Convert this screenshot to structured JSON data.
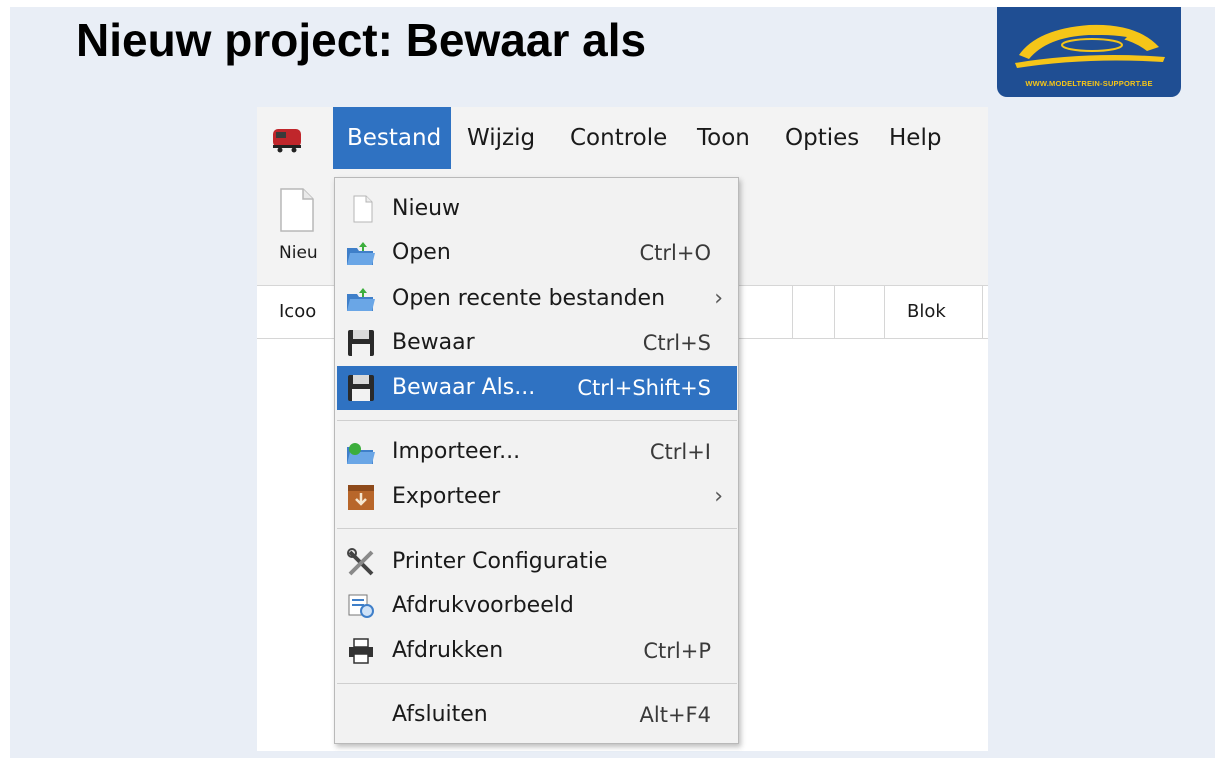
{
  "slide": {
    "title": "Nieuw project: Bewaar als",
    "logo_text": "WWW.MODELTREIN-SUPPORT.BE"
  },
  "menubar": {
    "items": [
      {
        "label": "Bestand",
        "active": true
      },
      {
        "label": "Wijzig"
      },
      {
        "label": "Controle"
      },
      {
        "label": "Toon"
      },
      {
        "label": "Opties"
      },
      {
        "label": "Help"
      }
    ]
  },
  "ribbon": {
    "new_label": "Nieu"
  },
  "grid": {
    "columns": [
      "Icoo",
      "",
      "",
      "Blok"
    ]
  },
  "dropdown": {
    "items": [
      {
        "label": "Nieuw",
        "shortcut": "",
        "icon": "new-document-icon"
      },
      {
        "label": "Open",
        "shortcut": "Ctrl+O",
        "icon": "open-folder-icon"
      },
      {
        "label": "Open recente bestanden",
        "shortcut": "",
        "submenu": true,
        "icon": "open-folder-icon"
      },
      {
        "label": "Bewaar",
        "shortcut": "Ctrl+S",
        "icon": "floppy-disk-icon"
      },
      {
        "label": "Bewaar Als...",
        "shortcut": "Ctrl+Shift+S",
        "highlighted": true,
        "icon": "floppy-disk-icon"
      },
      {
        "label": "Importeer...",
        "shortcut": "Ctrl+I",
        "icon": "import-icon"
      },
      {
        "label": "Exporteer",
        "shortcut": "",
        "submenu": true,
        "icon": "export-box-icon"
      },
      {
        "label": "Printer Configuratie",
        "shortcut": "",
        "icon": "tools-icon"
      },
      {
        "label": "Afdrukvoorbeeld",
        "shortcut": "",
        "icon": "print-preview-icon"
      },
      {
        "label": "Afdrukken",
        "shortcut": "Ctrl+P",
        "icon": "printer-icon"
      },
      {
        "label": "Afsluiten",
        "shortcut": "Alt+F4",
        "icon": ""
      }
    ],
    "submenu_arrow": "›"
  },
  "colors": {
    "slide_bg": "#e9eef6",
    "highlight": "#2f72c2",
    "logo_bg": "#1f4e93",
    "logo_accent": "#f5c518"
  }
}
